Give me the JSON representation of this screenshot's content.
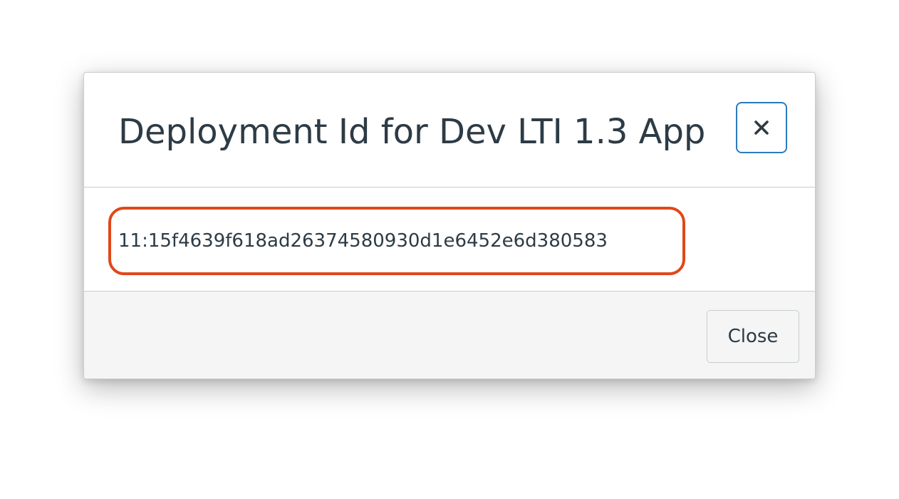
{
  "dialog": {
    "title": "Deployment Id for Dev LTI 1.3 App",
    "close_icon": "close-icon",
    "deployment_id": "11:15f4639f618ad26374580930d1e6452e6d380583",
    "close_button_label": "Close"
  },
  "colors": {
    "text": "#2d3b45",
    "focus_ring": "#2b7abc",
    "highlight": "#e0481a",
    "footer_bg": "#f5f5f5",
    "border": "#c7cdd1"
  }
}
